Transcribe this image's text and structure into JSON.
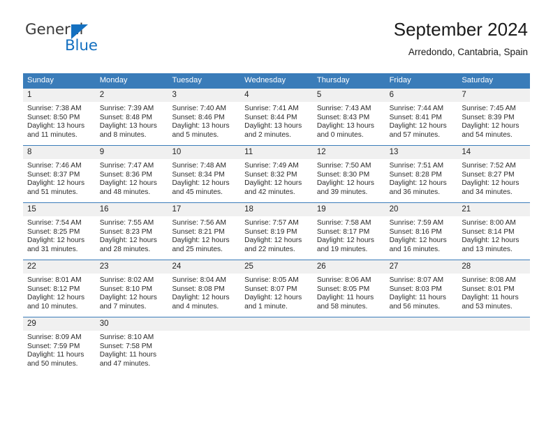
{
  "logo": {
    "word_one": "General",
    "word_two": "Blue",
    "triangle_color": "#1470c0",
    "text_color": "#3b3b3b"
  },
  "header": {
    "title": "September 2024",
    "subtitle": "Arredondo, Cantabria, Spain"
  },
  "theme": {
    "header_blue": "#3a7cb9",
    "daynum_band": "#f0f0f0",
    "text": "#222222"
  },
  "weekdays": [
    "Sunday",
    "Monday",
    "Tuesday",
    "Wednesday",
    "Thursday",
    "Friday",
    "Saturday"
  ],
  "weeks": [
    [
      {
        "day": "1",
        "sunrise": "Sunrise: 7:38 AM",
        "sunset": "Sunset: 8:50 PM",
        "daylight1": "Daylight: 13 hours",
        "daylight2": "and 11 minutes."
      },
      {
        "day": "2",
        "sunrise": "Sunrise: 7:39 AM",
        "sunset": "Sunset: 8:48 PM",
        "daylight1": "Daylight: 13 hours",
        "daylight2": "and 8 minutes."
      },
      {
        "day": "3",
        "sunrise": "Sunrise: 7:40 AM",
        "sunset": "Sunset: 8:46 PM",
        "daylight1": "Daylight: 13 hours",
        "daylight2": "and 5 minutes."
      },
      {
        "day": "4",
        "sunrise": "Sunrise: 7:41 AM",
        "sunset": "Sunset: 8:44 PM",
        "daylight1": "Daylight: 13 hours",
        "daylight2": "and 2 minutes."
      },
      {
        "day": "5",
        "sunrise": "Sunrise: 7:43 AM",
        "sunset": "Sunset: 8:43 PM",
        "daylight1": "Daylight: 13 hours",
        "daylight2": "and 0 minutes."
      },
      {
        "day": "6",
        "sunrise": "Sunrise: 7:44 AM",
        "sunset": "Sunset: 8:41 PM",
        "daylight1": "Daylight: 12 hours",
        "daylight2": "and 57 minutes."
      },
      {
        "day": "7",
        "sunrise": "Sunrise: 7:45 AM",
        "sunset": "Sunset: 8:39 PM",
        "daylight1": "Daylight: 12 hours",
        "daylight2": "and 54 minutes."
      }
    ],
    [
      {
        "day": "8",
        "sunrise": "Sunrise: 7:46 AM",
        "sunset": "Sunset: 8:37 PM",
        "daylight1": "Daylight: 12 hours",
        "daylight2": "and 51 minutes."
      },
      {
        "day": "9",
        "sunrise": "Sunrise: 7:47 AM",
        "sunset": "Sunset: 8:36 PM",
        "daylight1": "Daylight: 12 hours",
        "daylight2": "and 48 minutes."
      },
      {
        "day": "10",
        "sunrise": "Sunrise: 7:48 AM",
        "sunset": "Sunset: 8:34 PM",
        "daylight1": "Daylight: 12 hours",
        "daylight2": "and 45 minutes."
      },
      {
        "day": "11",
        "sunrise": "Sunrise: 7:49 AM",
        "sunset": "Sunset: 8:32 PM",
        "daylight1": "Daylight: 12 hours",
        "daylight2": "and 42 minutes."
      },
      {
        "day": "12",
        "sunrise": "Sunrise: 7:50 AM",
        "sunset": "Sunset: 8:30 PM",
        "daylight1": "Daylight: 12 hours",
        "daylight2": "and 39 minutes."
      },
      {
        "day": "13",
        "sunrise": "Sunrise: 7:51 AM",
        "sunset": "Sunset: 8:28 PM",
        "daylight1": "Daylight: 12 hours",
        "daylight2": "and 36 minutes."
      },
      {
        "day": "14",
        "sunrise": "Sunrise: 7:52 AM",
        "sunset": "Sunset: 8:27 PM",
        "daylight1": "Daylight: 12 hours",
        "daylight2": "and 34 minutes."
      }
    ],
    [
      {
        "day": "15",
        "sunrise": "Sunrise: 7:54 AM",
        "sunset": "Sunset: 8:25 PM",
        "daylight1": "Daylight: 12 hours",
        "daylight2": "and 31 minutes."
      },
      {
        "day": "16",
        "sunrise": "Sunrise: 7:55 AM",
        "sunset": "Sunset: 8:23 PM",
        "daylight1": "Daylight: 12 hours",
        "daylight2": "and 28 minutes."
      },
      {
        "day": "17",
        "sunrise": "Sunrise: 7:56 AM",
        "sunset": "Sunset: 8:21 PM",
        "daylight1": "Daylight: 12 hours",
        "daylight2": "and 25 minutes."
      },
      {
        "day": "18",
        "sunrise": "Sunrise: 7:57 AM",
        "sunset": "Sunset: 8:19 PM",
        "daylight1": "Daylight: 12 hours",
        "daylight2": "and 22 minutes."
      },
      {
        "day": "19",
        "sunrise": "Sunrise: 7:58 AM",
        "sunset": "Sunset: 8:17 PM",
        "daylight1": "Daylight: 12 hours",
        "daylight2": "and 19 minutes."
      },
      {
        "day": "20",
        "sunrise": "Sunrise: 7:59 AM",
        "sunset": "Sunset: 8:16 PM",
        "daylight1": "Daylight: 12 hours",
        "daylight2": "and 16 minutes."
      },
      {
        "day": "21",
        "sunrise": "Sunrise: 8:00 AM",
        "sunset": "Sunset: 8:14 PM",
        "daylight1": "Daylight: 12 hours",
        "daylight2": "and 13 minutes."
      }
    ],
    [
      {
        "day": "22",
        "sunrise": "Sunrise: 8:01 AM",
        "sunset": "Sunset: 8:12 PM",
        "daylight1": "Daylight: 12 hours",
        "daylight2": "and 10 minutes."
      },
      {
        "day": "23",
        "sunrise": "Sunrise: 8:02 AM",
        "sunset": "Sunset: 8:10 PM",
        "daylight1": "Daylight: 12 hours",
        "daylight2": "and 7 minutes."
      },
      {
        "day": "24",
        "sunrise": "Sunrise: 8:04 AM",
        "sunset": "Sunset: 8:08 PM",
        "daylight1": "Daylight: 12 hours",
        "daylight2": "and 4 minutes."
      },
      {
        "day": "25",
        "sunrise": "Sunrise: 8:05 AM",
        "sunset": "Sunset: 8:07 PM",
        "daylight1": "Daylight: 12 hours",
        "daylight2": "and 1 minute."
      },
      {
        "day": "26",
        "sunrise": "Sunrise: 8:06 AM",
        "sunset": "Sunset: 8:05 PM",
        "daylight1": "Daylight: 11 hours",
        "daylight2": "and 58 minutes."
      },
      {
        "day": "27",
        "sunrise": "Sunrise: 8:07 AM",
        "sunset": "Sunset: 8:03 PM",
        "daylight1": "Daylight: 11 hours",
        "daylight2": "and 56 minutes."
      },
      {
        "day": "28",
        "sunrise": "Sunrise: 8:08 AM",
        "sunset": "Sunset: 8:01 PM",
        "daylight1": "Daylight: 11 hours",
        "daylight2": "and 53 minutes."
      }
    ],
    [
      {
        "day": "29",
        "sunrise": "Sunrise: 8:09 AM",
        "sunset": "Sunset: 7:59 PM",
        "daylight1": "Daylight: 11 hours",
        "daylight2": "and 50 minutes."
      },
      {
        "day": "30",
        "sunrise": "Sunrise: 8:10 AM",
        "sunset": "Sunset: 7:58 PM",
        "daylight1": "Daylight: 11 hours",
        "daylight2": "and 47 minutes."
      },
      {
        "day": "",
        "sunrise": "",
        "sunset": "",
        "daylight1": "",
        "daylight2": ""
      },
      {
        "day": "",
        "sunrise": "",
        "sunset": "",
        "daylight1": "",
        "daylight2": ""
      },
      {
        "day": "",
        "sunrise": "",
        "sunset": "",
        "daylight1": "",
        "daylight2": ""
      },
      {
        "day": "",
        "sunrise": "",
        "sunset": "",
        "daylight1": "",
        "daylight2": ""
      },
      {
        "day": "",
        "sunrise": "",
        "sunset": "",
        "daylight1": "",
        "daylight2": ""
      }
    ]
  ]
}
